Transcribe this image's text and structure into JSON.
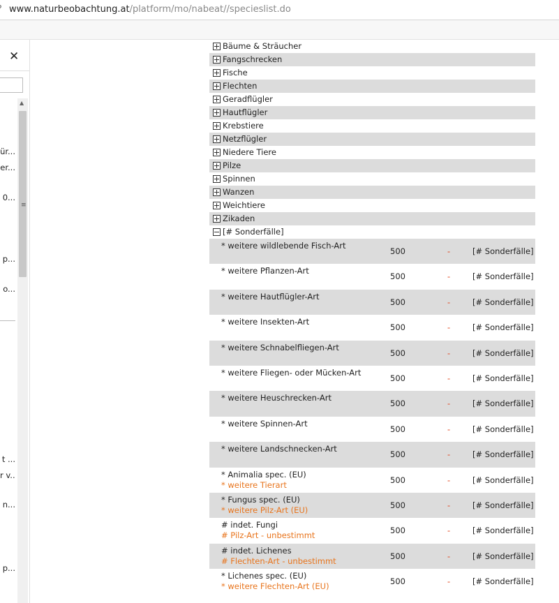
{
  "browser": {
    "url_host": "www.naturbeobachtung.at",
    "url_path": "/platform/mo/nabeat//specieslist.do",
    "lead_glyph": "?"
  },
  "sidebar": {
    "close_glyph": "✕",
    "truncated_items": [
      "ür...",
      "er...",
      "0...",
      "p...",
      "o...",
      "t ...",
      "r v...",
      "n...",
      "p...",
      "..."
    ]
  },
  "categories": [
    {
      "label": "Bäume & Sträucher",
      "state": "collapsed"
    },
    {
      "label": "Fangschrecken",
      "state": "collapsed"
    },
    {
      "label": "Fische",
      "state": "collapsed"
    },
    {
      "label": "Flechten",
      "state": "collapsed"
    },
    {
      "label": "Geradflügler",
      "state": "collapsed"
    },
    {
      "label": "Hautflügler",
      "state": "collapsed"
    },
    {
      "label": "Krebstiere",
      "state": "collapsed"
    },
    {
      "label": "Netzflügler",
      "state": "collapsed"
    },
    {
      "label": "Niedere Tiere",
      "state": "collapsed"
    },
    {
      "label": "Pilze",
      "state": "collapsed"
    },
    {
      "label": "Spinnen",
      "state": "collapsed"
    },
    {
      "label": "Wanzen",
      "state": "collapsed"
    },
    {
      "label": "Weichtiere",
      "state": "collapsed"
    },
    {
      "label": "Zikaden",
      "state": "collapsed"
    },
    {
      "label": "[# Sonderfälle]",
      "state": "expanded"
    }
  ],
  "species": [
    {
      "name": "* weitere wildlebende Fisch-Art",
      "desc": "",
      "code": "500",
      "dash": "-",
      "group": "[# Sonderfälle]"
    },
    {
      "name": "* weitere Pflanzen-Art",
      "desc": "",
      "code": "500",
      "dash": "-",
      "group": "[# Sonderfälle]"
    },
    {
      "name": "* weitere Hautflügler-Art",
      "desc": "",
      "code": "500",
      "dash": "-",
      "group": "[# Sonderfälle]"
    },
    {
      "name": "* weitere Insekten-Art",
      "desc": "",
      "code": "500",
      "dash": "-",
      "group": "[# Sonderfälle]"
    },
    {
      "name": "* weitere Schnabelfliegen-Art",
      "desc": "",
      "code": "500",
      "dash": "-",
      "group": "[# Sonderfälle]"
    },
    {
      "name": "* weitere Fliegen- oder Mücken-Art",
      "desc": "",
      "code": "500",
      "dash": "-",
      "group": "[# Sonderfälle]"
    },
    {
      "name": "* weitere Heuschrecken-Art",
      "desc": "",
      "code": "500",
      "dash": "-",
      "group": "[# Sonderfälle]"
    },
    {
      "name": "* weitere Spinnen-Art",
      "desc": "",
      "code": "500",
      "dash": "-",
      "group": "[# Sonderfälle]"
    },
    {
      "name": "* weitere Landschnecken-Art",
      "desc": "",
      "code": "500",
      "dash": "-",
      "group": "[# Sonderfälle]"
    },
    {
      "name": "* Animalia spec. (EU)",
      "desc": "* weitere Tierart",
      "code": "500",
      "dash": "-",
      "group": "[# Sonderfälle]"
    },
    {
      "name": "* Fungus spec. (EU)",
      "desc": "* weitere Pilz-Art (EU)",
      "code": "500",
      "dash": "-",
      "group": "[# Sonderfälle]"
    },
    {
      "name": "# indet. Fungi",
      "desc": "# Pilz-Art - unbestimmt",
      "code": "500",
      "dash": "-",
      "group": "[# Sonderfälle]"
    },
    {
      "name": "# indet. Lichenes",
      "desc": "# Flechten-Art - unbestimmt",
      "code": "500",
      "dash": "-",
      "group": "[# Sonderfälle]"
    },
    {
      "name": "* Lichenes spec. (EU)",
      "desc": "* weitere Flechten-Art (EU)",
      "code": "500",
      "dash": "-",
      "group": "[# Sonderfälle]"
    }
  ]
}
